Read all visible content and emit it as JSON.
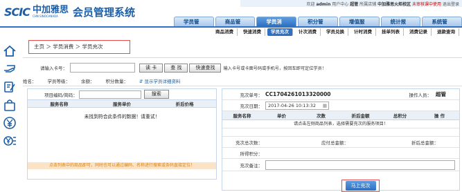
{
  "topbar": {
    "welcome": "欢迎",
    "user": "admin",
    "account_center": "用户中心",
    "store_prefix": "超管",
    "store_label": "所属店铺",
    "store_name": "中加雅思火炬校区",
    "switch": "未审核课中使用",
    "logout": "退出登录"
  },
  "logo": {
    "mark": "SCIC",
    "cn": "中加雅思",
    "en": "CHN SINOCANADA",
    "title": "会员管理系统"
  },
  "nav_tabs": [
    {
      "label": "学员管理"
    },
    {
      "label": "商品管理"
    },
    {
      "label": "学员消费"
    },
    {
      "label": "积分管理"
    },
    {
      "label": "增值服务"
    },
    {
      "label": "统计报表"
    },
    {
      "label": "系统管理"
    }
  ],
  "sub_nav": [
    {
      "label": "商品消费"
    },
    {
      "label": "快速消费"
    },
    {
      "label": "学员充次"
    },
    {
      "label": "计次消费"
    },
    {
      "label": "学员兑换"
    },
    {
      "label": "计时消费"
    },
    {
      "label": "挂单列表"
    },
    {
      "label": "消费记录"
    },
    {
      "label": "退款查询"
    }
  ],
  "breadcrumb": "主页 ＞ 学员消费 ＞ 学员充次",
  "card_search": {
    "label": "请输入卡号：",
    "read_card": "读 卡",
    "search": "查 找",
    "quick_search": "快速查找",
    "hint": "输入卡号或卡面号码或手机号，按回车即可定位学员！"
  },
  "member_info": {
    "name": "姓名：",
    "level": "学员等级：",
    "balance": "余额：",
    "points": "积分数量：",
    "detail_link": "显示学员详细资料"
  },
  "product": {
    "search_label": "项目编码/简码：",
    "search_btn": "搜索",
    "col_name": "服务名称",
    "col_price": "服务单价",
    "col_discount": "折后价格",
    "empty": "未找到符合此条件的数据！请重试！",
    "notice": "点击列表中的商品即可，同时也可以通过编码、名称进行搜索或条码直接定位！"
  },
  "order": {
    "no_label": "充次单号：",
    "no_value": "CC1704261013320000",
    "operator_label": "操作人员：",
    "operator_value": "超管",
    "date_label": "充次日期：",
    "date_value": "2017-04-26 10:13:32",
    "cols": [
      "服务名称",
      "单价",
      "次数",
      "折后金额",
      "总积分",
      "操 作"
    ],
    "hint": "请点击左侧商品列表，选择需要充次的服务项目！",
    "total_count": "充次总次数：",
    "total_due": "应付总金额：",
    "total_discount": "折后总金额：",
    "points": "所得积分：",
    "remark": "充次备注：",
    "submit": "马上充次"
  }
}
